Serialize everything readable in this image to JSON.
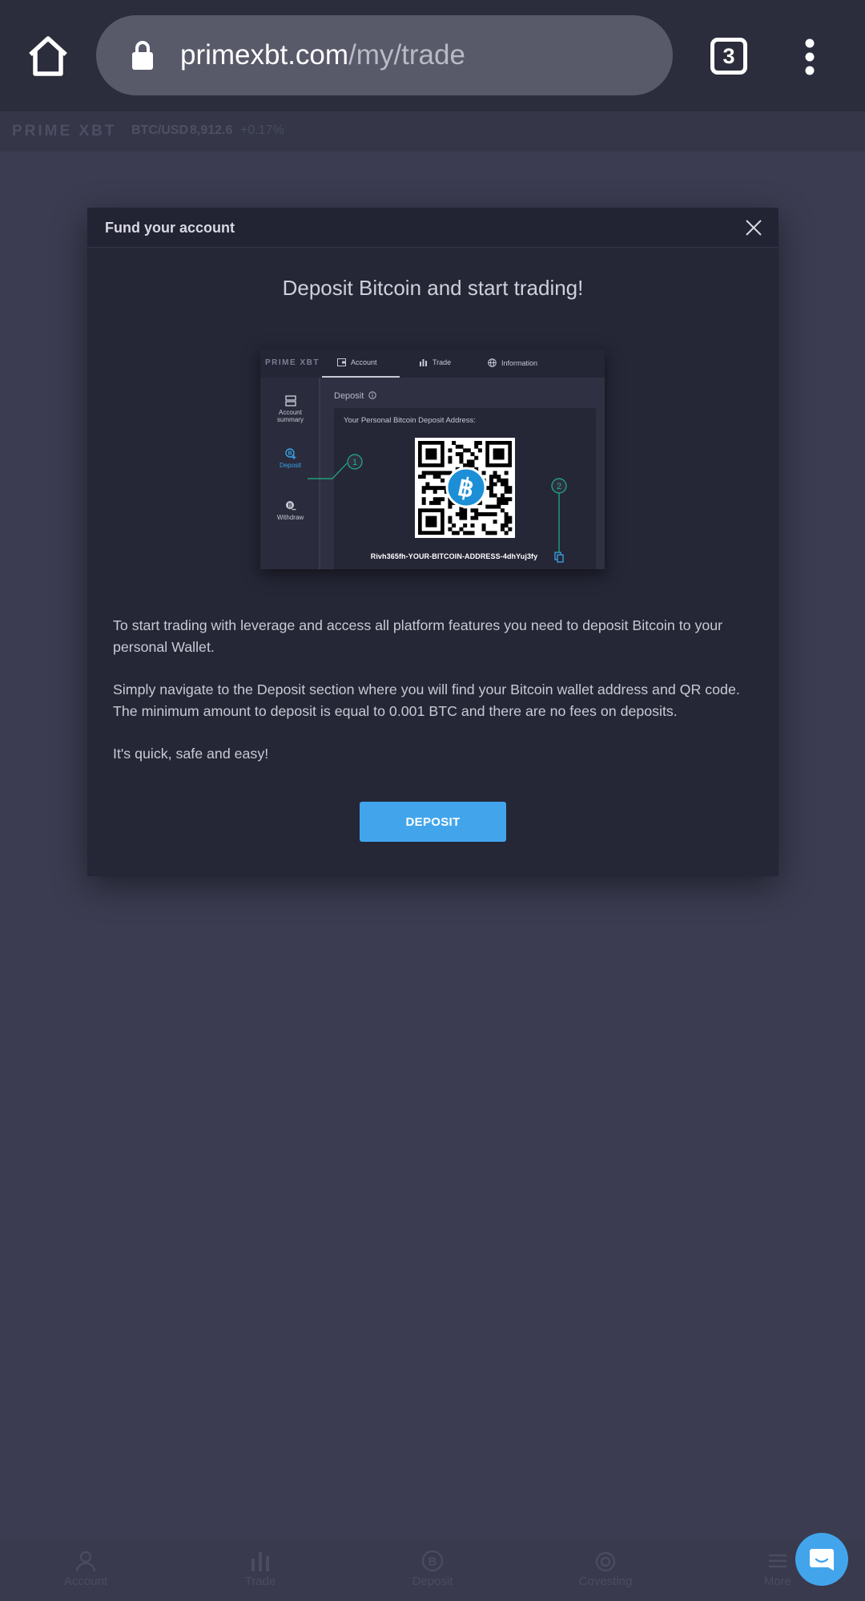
{
  "browser": {
    "url_host": "primexbt.com",
    "url_path": "/my/trade",
    "tab_count": "3",
    "icons": [
      "home-icon",
      "lock-icon",
      "tabs-icon",
      "more-vert-icon"
    ]
  },
  "app_header": {
    "logo": "PRIME XBT",
    "pair": "BTC/USD",
    "price": "8,912.6",
    "change": "+0.17%"
  },
  "modal": {
    "title": "Fund your account",
    "heading": "Deposit Bitcoin and start trading!",
    "illustration": {
      "logo": "PRIME XBT",
      "tabs": [
        "Account",
        "Trade",
        "Information"
      ],
      "sidebar": [
        "Account summary",
        "Deposit",
        "Withdraw"
      ],
      "section_label": "Deposit",
      "address_label": "Your Personal Bitcoin Deposit Address:",
      "address": "Rivh365fh-YOUR-BITCOIN-ADDRESS-4dhYuj3fy",
      "callouts": [
        "1",
        "2"
      ]
    },
    "paragraphs": [
      "To start trading with leverage and access all platform features you need to deposit Bitcoin to your personal Wallet.",
      "Simply navigate to the Deposit section where you will find your Bitcoin wallet address and QR code. The minimum amount to deposit is equal to 0.001 BTC and there are no fees on deposits.",
      "It's quick, safe and easy!"
    ],
    "button_label": "DEPOSIT"
  },
  "bottom_nav": {
    "items": [
      "Account",
      "Trade",
      "Deposit",
      "Covesting",
      "More"
    ]
  },
  "colors": {
    "accent": "#42a5ec",
    "background": "#3b3c51",
    "modal": "#252636",
    "callout_green": "#1fb489"
  }
}
